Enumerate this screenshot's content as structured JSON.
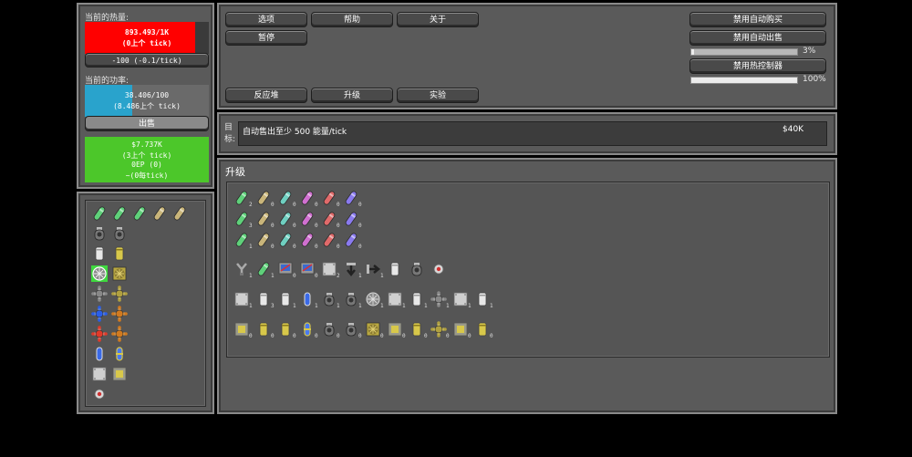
{
  "colors": {
    "heat": "#ff0000",
    "power": "#29a3cc",
    "money": "#4cc72a",
    "panel": "#5a5a5a"
  },
  "heat": {
    "label": "当前的热量:",
    "value": "893.493/1K",
    "tick": "(0上个 tick)",
    "vent": "-100 (-0.1/tick)"
  },
  "power": {
    "label": "当前的功率:",
    "value": "38.406/100",
    "tick": "(8.486上个 tick)",
    "sell": "出售"
  },
  "money": {
    "value": "$7.737K",
    "tick": "(3上个 tick)",
    "ep": "0EP (0)",
    "ep_tick": "~(0每tick)"
  },
  "top_buttons": {
    "options": "选项",
    "help": "帮助",
    "about": "关于",
    "pause": "暂停",
    "reactor": "反应堆",
    "upgrades": "升级",
    "experiments": "实验"
  },
  "toggles": {
    "auto_buy": "禁用自动购买",
    "auto_sell": "禁用自动出售",
    "auto_sell_pct": "3%",
    "heat_ctrl": "禁用热控制器",
    "heat_ctrl_pct": "100%",
    "auto_sell_level": 0.03,
    "heat_ctrl_level": 1.0
  },
  "objective": {
    "label": "目标:",
    "text": "自动售出至少 500 能量/tick",
    "reward": "$40K"
  },
  "upgrades_title": "升级",
  "parts": [
    [
      "cell-green",
      "cell-green",
      "cell-green",
      "cell-tan",
      "cell-tan"
    ],
    [
      "vent-dark",
      "vent-dark"
    ],
    [
      "canister-white",
      "canister-yellow"
    ],
    [
      "fan-selected",
      "fan-yellow"
    ],
    [
      "star-gray",
      "star-yellow"
    ],
    [
      "star-blue",
      "star-orange"
    ],
    [
      "star-red",
      "star-orange"
    ],
    [
      "capsule-blue",
      "capsule-clip"
    ],
    [
      "plate-white",
      "plate-yellow"
    ],
    [
      "disc-red"
    ]
  ],
  "upgrade_rows": [
    [
      {
        "icon": "cell-green",
        "count": "2"
      },
      {
        "icon": "cell-tan",
        "count": "0"
      },
      {
        "icon": "cell-teal",
        "count": "0"
      },
      {
        "icon": "cell-magenta",
        "count": "0"
      },
      {
        "icon": "cell-red",
        "count": "0"
      },
      {
        "icon": "cell-purple",
        "count": "0"
      }
    ],
    [
      {
        "icon": "cell-green",
        "count": "3"
      },
      {
        "icon": "cell-tan",
        "count": "0"
      },
      {
        "icon": "cell-teal",
        "count": "0"
      },
      {
        "icon": "cell-magenta",
        "count": "0"
      },
      {
        "icon": "cell-red",
        "count": "0"
      },
      {
        "icon": "cell-purple",
        "count": "0"
      }
    ],
    [
      {
        "icon": "cell-green",
        "count": "1"
      },
      {
        "icon": "cell-tan",
        "count": "0"
      },
      {
        "icon": "cell-teal",
        "count": "0"
      },
      {
        "icon": "cell-magenta",
        "count": "0"
      },
      {
        "icon": "cell-red",
        "count": "0"
      },
      {
        "icon": "cell-purple",
        "count": "0"
      }
    ],
    [
      {
        "icon": "tool-y",
        "count": "1"
      },
      {
        "icon": "cell-green",
        "count": "1"
      },
      {
        "icon": "monitor",
        "count": "0"
      },
      {
        "icon": "monitor",
        "count": "0"
      },
      {
        "icon": "plate-white",
        "count": "2"
      },
      {
        "icon": "arrow-down",
        "count": "1"
      },
      {
        "icon": "arrow-right",
        "count": "1"
      },
      {
        "icon": "canister-white",
        "count": ""
      },
      {
        "icon": "vent-dark",
        "count": ""
      },
      {
        "icon": "disc-red",
        "count": ""
      }
    ],
    [
      {
        "icon": "plate-white",
        "count": "1"
      },
      {
        "icon": "canister-white",
        "count": "3"
      },
      {
        "icon": "canister-white",
        "count": "1"
      },
      {
        "icon": "capsule-blue",
        "count": "1"
      },
      {
        "icon": "vent-dark",
        "count": "1"
      },
      {
        "icon": "vent-dark",
        "count": "1"
      },
      {
        "icon": "fan-gray",
        "count": "1"
      },
      {
        "icon": "plate-white",
        "count": "1"
      },
      {
        "icon": "canister-white",
        "count": "1"
      },
      {
        "icon": "star-gray",
        "count": "1"
      },
      {
        "icon": "plate-white",
        "count": "1"
      },
      {
        "icon": "canister-white",
        "count": "1"
      }
    ],
    [
      {
        "icon": "plate-yellow",
        "count": "0"
      },
      {
        "icon": "canister-yellow",
        "count": "0"
      },
      {
        "icon": "canister-yellow",
        "count": "0"
      },
      {
        "icon": "capsule-clip",
        "count": "0"
      },
      {
        "icon": "vent-dark",
        "count": "0"
      },
      {
        "icon": "vent-dark",
        "count": "0"
      },
      {
        "icon": "fan-yellow",
        "count": "0"
      },
      {
        "icon": "plate-yellow",
        "count": "0"
      },
      {
        "icon": "canister-yellow",
        "count": "0"
      },
      {
        "icon": "star-yellow",
        "count": "0"
      },
      {
        "icon": "plate-yellow",
        "count": "0"
      },
      {
        "icon": "canister-yellow",
        "count": "0"
      }
    ]
  ]
}
